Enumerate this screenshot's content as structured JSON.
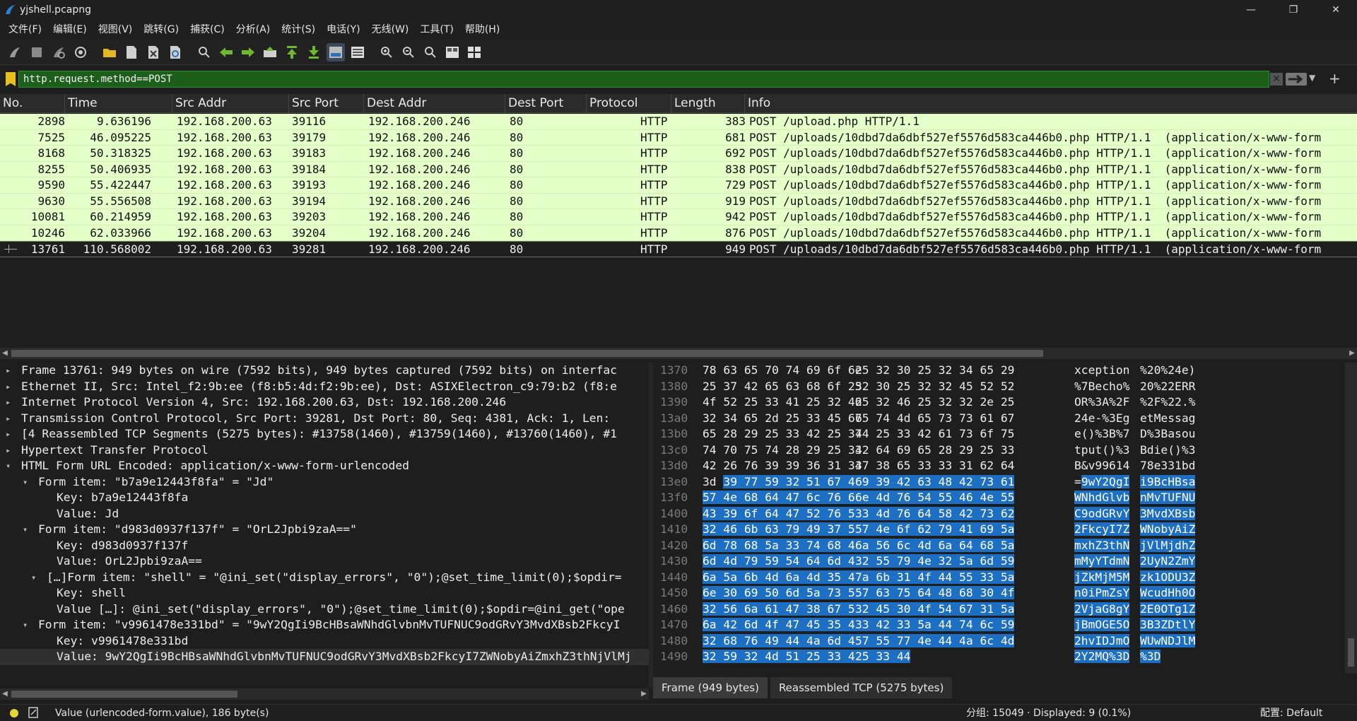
{
  "window": {
    "title": "yjshell.pcapng",
    "minimize": "—",
    "maximize": "❐",
    "close": "✕"
  },
  "menu": [
    "文件(F)",
    "编辑(E)",
    "视图(V)",
    "跳转(G)",
    "捕获(C)",
    "分析(A)",
    "统计(S)",
    "电话(Y)",
    "无线(W)",
    "工具(T)",
    "帮助(H)"
  ],
  "filter": {
    "value": "http.request.method==POST",
    "plus": "+"
  },
  "columns": {
    "no": "No.",
    "time": "Time",
    "src": "Src Addr",
    "sport": "Src Port",
    "dst": "Dest Addr",
    "dport": "Dest Port",
    "proto": "Protocol",
    "len": "Length",
    "info": "Info"
  },
  "packets": [
    {
      "no": "2898",
      "time": "9.636196",
      "src": "192.168.200.63",
      "sport": "39116",
      "dst": "192.168.200.246",
      "dport": "80",
      "proto": "HTTP",
      "len": "383",
      "info": "POST /upload.php HTTP/1.1"
    },
    {
      "no": "7525",
      "time": "46.095225",
      "src": "192.168.200.63",
      "sport": "39179",
      "dst": "192.168.200.246",
      "dport": "80",
      "proto": "HTTP",
      "len": "681",
      "info": "POST /uploads/10dbd7da6dbf527ef5576d583ca446b0.php HTTP/1.1  (application/x-www-form"
    },
    {
      "no": "8168",
      "time": "50.318325",
      "src": "192.168.200.63",
      "sport": "39183",
      "dst": "192.168.200.246",
      "dport": "80",
      "proto": "HTTP",
      "len": "692",
      "info": "POST /uploads/10dbd7da6dbf527ef5576d583ca446b0.php HTTP/1.1  (application/x-www-form"
    },
    {
      "no": "8255",
      "time": "50.406935",
      "src": "192.168.200.63",
      "sport": "39184",
      "dst": "192.168.200.246",
      "dport": "80",
      "proto": "HTTP",
      "len": "838",
      "info": "POST /uploads/10dbd7da6dbf527ef5576d583ca446b0.php HTTP/1.1  (application/x-www-form"
    },
    {
      "no": "9590",
      "time": "55.422447",
      "src": "192.168.200.63",
      "sport": "39193",
      "dst": "192.168.200.246",
      "dport": "80",
      "proto": "HTTP",
      "len": "729",
      "info": "POST /uploads/10dbd7da6dbf527ef5576d583ca446b0.php HTTP/1.1  (application/x-www-form"
    },
    {
      "no": "9630",
      "time": "55.556508",
      "src": "192.168.200.63",
      "sport": "39194",
      "dst": "192.168.200.246",
      "dport": "80",
      "proto": "HTTP",
      "len": "919",
      "info": "POST /uploads/10dbd7da6dbf527ef5576d583ca446b0.php HTTP/1.1  (application/x-www-form"
    },
    {
      "no": "10081",
      "time": "60.214959",
      "src": "192.168.200.63",
      "sport": "39203",
      "dst": "192.168.200.246",
      "dport": "80",
      "proto": "HTTP",
      "len": "942",
      "info": "POST /uploads/10dbd7da6dbf527ef5576d583ca446b0.php HTTP/1.1  (application/x-www-form"
    },
    {
      "no": "10246",
      "time": "62.033966",
      "src": "192.168.200.63",
      "sport": "39204",
      "dst": "192.168.200.246",
      "dport": "80",
      "proto": "HTTP",
      "len": "876",
      "info": "POST /uploads/10dbd7da6dbf527ef5576d583ca446b0.php HTTP/1.1  (application/x-www-form"
    },
    {
      "no": "13761",
      "time": "110.568002",
      "src": "192.168.200.63",
      "sport": "39281",
      "dst": "192.168.200.246",
      "dport": "80",
      "proto": "HTTP",
      "len": "949",
      "info": "POST /uploads/10dbd7da6dbf527ef5576d583ca446b0.php HTTP/1.1  (application/x-www-form",
      "selected": true
    }
  ],
  "details": [
    {
      "tw": "▸",
      "text": "Frame 13761: 949 bytes on wire (7592 bits), 949 bytes captured (7592 bits) on interfac",
      "level": 0
    },
    {
      "tw": "▸",
      "text": "Ethernet II, Src: Intel_f2:9b:ee (f8:b5:4d:f2:9b:ee), Dst: ASIXElectron_c9:79:b2 (f8:e",
      "level": 0
    },
    {
      "tw": "▸",
      "text": "Internet Protocol Version 4, Src: 192.168.200.63, Dst: 192.168.200.246",
      "level": 0
    },
    {
      "tw": "▸",
      "text": "Transmission Control Protocol, Src Port: 39281, Dst Port: 80, Seq: 4381, Ack: 1, Len:",
      "level": 0
    },
    {
      "tw": "▸",
      "text": "[4 Reassembled TCP Segments (5275 bytes): #13758(1460), #13759(1460), #13760(1460), #1",
      "level": 0
    },
    {
      "tw": "▸",
      "text": "Hypertext Transfer Protocol",
      "level": 0
    },
    {
      "tw": "▾",
      "text": "HTML Form URL Encoded: application/x-www-form-urlencoded",
      "level": 0
    },
    {
      "tw": "▾",
      "text": "Form item: \"b7a9e12443f8fa\" = \"Jd\"",
      "level": 1
    },
    {
      "tw": "",
      "text": "Key: b7a9e12443f8fa",
      "level": 2
    },
    {
      "tw": "",
      "text": "Value: Jd",
      "level": 2
    },
    {
      "tw": "▾",
      "text": "Form item: \"d983d0937f137f\" = \"OrL2Jpbi9zaA==\"",
      "level": 1
    },
    {
      "tw": "",
      "text": "Key: d983d0937f137f",
      "level": 2
    },
    {
      "tw": "",
      "text": "Value: OrL2Jpbi9zaA==",
      "level": 2
    },
    {
      "tw": "▾",
      "text": "[…]Form item: \"shell\" = \"@ini_set(\"display_errors\", \"0\");@set_time_limit(0);$opdir=",
      "level": 1.5
    },
    {
      "tw": "",
      "text": "Key: shell",
      "level": 2
    },
    {
      "tw": "",
      "text": "Value […]: @ini_set(\"display_errors\", \"0\");@set_time_limit(0);$opdir=@ini_get(\"ope",
      "level": 2
    },
    {
      "tw": "▾",
      "text": "Form item: \"v9961478e331bd\" = \"9wY2QgIi9BcHBsaWNhdGlvbnMvTUFNUC9odGRvY3MvdXBsb2FkcyI",
      "level": 1
    },
    {
      "tw": "",
      "text": "Key: v9961478e331bd",
      "level": 2
    },
    {
      "tw": "",
      "text": "Value: 9wY2QgIi9BcHBsaWNhdGlvbnMvTUFNUC9odGRvY3MvdXBsb2FkcyI7ZWNobyAiZmxhZ3thNjVlMj",
      "level": 2,
      "selected": true
    }
  ],
  "hex": [
    {
      "off": "1370",
      "h1": "78 63 65 70 74 69 6f 6e",
      "h2": "25 32 30 25 32 34 65 29",
      "a1": "xception",
      "a2": "%20%24e)",
      "hl": 0
    },
    {
      "off": "1380",
      "h1": "25 37 42 65 63 68 6f 25",
      "h2": "32 30 25 32 32 45 52 52",
      "a1": "%7Becho%",
      "a2": "20%22ERR",
      "hl": 0
    },
    {
      "off": "1390",
      "h1": "4f 52 25 33 41 25 32 46",
      "h2": "25 32 46 25 32 32 2e 25",
      "a1": "OR%3A%2F",
      "a2": "%2F%22.%",
      "hl": 0
    },
    {
      "off": "13a0",
      "h1": "32 34 65 2d 25 33 45 67",
      "h2": "65 74 4d 65 73 73 61 67",
      "a1": "24e-%3Eg",
      "a2": "etMessag",
      "hl": 0
    },
    {
      "off": "13b0",
      "h1": "65 28 29 25 33 42 25 37",
      "h2": "44 25 33 42 61 73 6f 75",
      "a1": "e()%3B%7",
      "a2": "D%3Basou",
      "hl": 0
    },
    {
      "off": "13c0",
      "h1": "74 70 75 74 28 29 25 33",
      "h2": "42 64 69 65 28 29 25 33",
      "a1": "tput()%3",
      "a2": "Bdie()%3",
      "hl": 0
    },
    {
      "off": "13d0",
      "h1": "42 26 76 39 39 36 31 34",
      "h2": "37 38 65 33 33 31 62 64",
      "a1": "B&v99614",
      "a2": "78e331bd",
      "hl": 0
    },
    {
      "off": "13e0",
      "h1p": "3d ",
      "h1": "39 77 59 32 51 67 49",
      "h2": "69 39 42 63 48 42 73 61",
      "a1p": "=",
      "a1": "9wY2QgI",
      "a2": "i9BcHBsa",
      "hl": 1
    },
    {
      "off": "13f0",
      "h1": "57 4e 68 64 47 6c 76 62",
      "h2": "6e 4d 76 54 55 46 4e 55",
      "a1": "WNhdGlvb",
      "a2": "nMvTUFNU",
      "hl": 2
    },
    {
      "off": "1400",
      "h1": "43 39 6f 64 47 52 76 59",
      "h2": "33 4d 76 64 58 42 73 62",
      "a1": "C9odGRvY",
      "a2": "3MvdXBsb",
      "hl": 2
    },
    {
      "off": "1410",
      "h1": "32 46 6b 63 79 49 37 5a",
      "h2": "57 4e 6f 62 79 41 69 5a",
      "a1": "2FkcyI7Z",
      "a2": "WNobyAiZ",
      "hl": 2
    },
    {
      "off": "1420",
      "h1": "6d 78 68 5a 33 74 68 4e",
      "h2": "6a 56 6c 4d 6a 64 68 5a",
      "a1": "mxhZ3thN",
      "a2": "jVlMjdhZ",
      "hl": 2
    },
    {
      "off": "1430",
      "h1": "6d 4d 79 59 54 64 6d 4e",
      "h2": "32 55 79 4e 32 5a 6d 59",
      "a1": "mMyYTdmN",
      "a2": "2UyN2ZmY",
      "hl": 2
    },
    {
      "off": "1440",
      "h1": "6a 5a 6b 4d 6a 4d 35 4d",
      "h2": "7a 6b 31 4f 44 55 33 5a",
      "a1": "jZkMjM5M",
      "a2": "zk1ODU3Z",
      "hl": 2
    },
    {
      "off": "1450",
      "h1": "6e 30 69 50 6d 5a 73 59",
      "h2": "57 63 75 64 48 68 30 4f",
      "a1": "n0iPmZsY",
      "a2": "WcudHh0O",
      "hl": 2
    },
    {
      "off": "1460",
      "h1": "32 56 6a 61 47 38 67 59",
      "h2": "32 45 30 4f 54 67 31 5a",
      "a1": "2VjaG8gY",
      "a2": "2E0OTg1Z",
      "hl": 2
    },
    {
      "off": "1470",
      "h1": "6a 42 6d 4f 47 45 35 4f",
      "h2": "33 42 33 5a 44 74 6c 59",
      "a1": "jBmOGE5O",
      "a2": "3B3ZDtlY",
      "hl": 2
    },
    {
      "off": "1480",
      "h1": "32 68 76 49 44 4a 6d 4f",
      "h2": "57 55 77 4e 44 4a 6c 4d",
      "a1": "2hvIDJmO",
      "a2": "WUwNDJlM",
      "hl": 2
    },
    {
      "off": "1490",
      "h1": "32 59 32 4d 51 25 33 44",
      "h2": "25 33 44",
      "a1": "2Y2MQ%3D",
      "a2": "%3D",
      "hl": 2
    }
  ],
  "byte_tabs": [
    "Frame (949 bytes)",
    "Reassembled TCP (5275 bytes)"
  ],
  "status": {
    "field": "Value (urlencoded-form.value), 186 byte(s)",
    "stats": "分组: 15049 · Displayed: 9 (0.1%)",
    "profile": "配置: Default"
  },
  "colors": {
    "http_row_bg": "#e4ffc7",
    "filter_valid_bg": "#1d5e1d",
    "selection_highlight": "#1d6fc4"
  },
  "icons": [
    "shark-fin-start-icon",
    "stop-square-icon",
    "restart-fin-icon",
    "capture-options-gear-icon",
    "open-folder-icon",
    "save-file-icon",
    "close-file-icon",
    "reload-icon",
    "find-icon",
    "go-back-icon",
    "go-forward-icon",
    "go-to-packet-icon",
    "first-packet-icon",
    "last-packet-icon",
    "autoscroll-icon",
    "colorize-icon",
    "zoom-in-icon",
    "zoom-out-icon",
    "zoom-reset-icon",
    "resize-columns-icon",
    "layout-icon"
  ]
}
